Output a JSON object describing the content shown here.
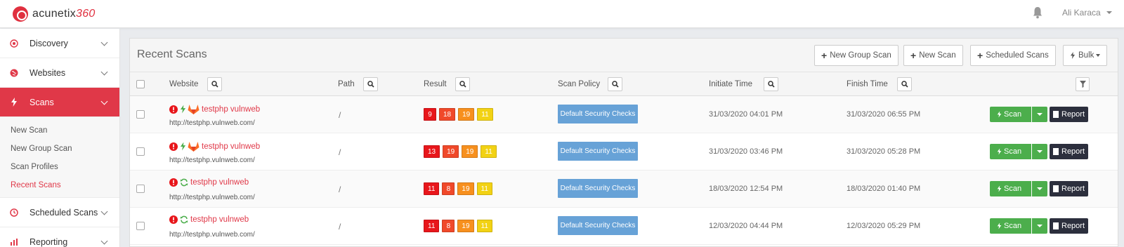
{
  "app": {
    "logo_text": "acunetix",
    "logo_suffix": "360",
    "user_name": "Ali Karaca"
  },
  "sidebar": {
    "items": [
      {
        "label": "Discovery",
        "icon": "target-icon"
      },
      {
        "label": "Websites",
        "icon": "globe-icon"
      },
      {
        "label": "Scans",
        "icon": "lightning-icon",
        "active": true
      },
      {
        "label": "Scheduled Scans",
        "icon": "clock-icon"
      },
      {
        "label": "Reporting",
        "icon": "bar-chart-icon"
      }
    ],
    "sub_items": [
      "New Scan",
      "New Group Scan",
      "Scan Profiles",
      "Recent Scans"
    ],
    "current_sub": "Recent Scans"
  },
  "panel": {
    "title": "Recent Scans",
    "buttons": {
      "new_group_scan": "New Group Scan",
      "new_scan": "New Scan",
      "scheduled_scans": "Scheduled Scans",
      "bulk": "Bulk"
    }
  },
  "table": {
    "columns": {
      "website": "Website",
      "path": "Path",
      "result": "Result",
      "scan_policy": "Scan Policy",
      "initiate_time": "Initiate Time",
      "finish_time": "Finish Time"
    },
    "rows": [
      {
        "name": "testphp vulnweb",
        "url": "http://testphp.vulnweb.com/",
        "path": "/",
        "result": [
          "9",
          "18",
          "19",
          "11"
        ],
        "policy": "Default Security Checks",
        "initiate": "31/03/2020 04:01 PM",
        "finish": "31/03/2020 06:55 PM",
        "icons": [
          "alert-icon",
          "lightning-icon",
          "gitlab-icon"
        ]
      },
      {
        "name": "testphp vulnweb",
        "url": "http://testphp.vulnweb.com/",
        "path": "/",
        "result": [
          "13",
          "19",
          "19",
          "11"
        ],
        "policy": "Default Security Checks",
        "initiate": "31/03/2020 03:46 PM",
        "finish": "31/03/2020 05:28 PM",
        "icons": [
          "alert-icon",
          "lightning-icon",
          "gitlab-icon"
        ]
      },
      {
        "name": "testphp vulnweb",
        "url": "http://testphp.vulnweb.com/",
        "path": "/",
        "result": [
          "11",
          "8",
          "19",
          "11"
        ],
        "policy": "Default Security Checks",
        "initiate": "18/03/2020 12:54 PM",
        "finish": "18/03/2020 01:40 PM",
        "icons": [
          "alert-icon",
          "refresh-icon"
        ]
      },
      {
        "name": "testphp vulnweb",
        "url": "http://testphp.vulnweb.com/",
        "path": "/",
        "result": [
          "11",
          "8",
          "19",
          "11"
        ],
        "policy": "Default Security Checks",
        "initiate": "12/03/2020 04:44 PM",
        "finish": "12/03/2020 05:29 PM",
        "icons": [
          "alert-icon",
          "refresh-icon"
        ]
      }
    ],
    "scan_label": "Scan",
    "report_label": "Report"
  },
  "colors": {
    "brand": "#e03848",
    "critical": "#e8161b",
    "high": "#f0492a",
    "medium": "#f7901e",
    "low": "#f2d214",
    "scan": "#4cae4c",
    "policy": "#67a2d7",
    "report": "#2c2f3d"
  }
}
